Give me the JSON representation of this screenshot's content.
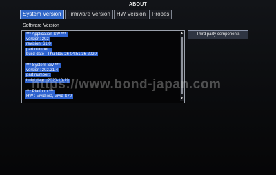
{
  "window": {
    "title": "ABOUT"
  },
  "tabs": [
    {
      "label": "System Version",
      "active": true
    },
    {
      "label": "Firmware Version",
      "active": false
    },
    {
      "label": "HW Version",
      "active": false
    },
    {
      "label": "Probes",
      "active": false
    }
  ],
  "software_version": {
    "label": "Software Version",
    "lines": [
      "*** Application SW ***",
      "version: 202",
      "revision: 61.0",
      "part number :",
      "build date : Thu Nov 26 04:51:36 2020",
      "",
      "*** System SW ***",
      "version: 202.21.4",
      "part number:",
      "build date : 2020-10-19",
      "",
      "*** Platform ***",
      "HW : Vivid i60, Vivid S70"
    ]
  },
  "buttons": {
    "third_party": "Third party components"
  },
  "watermark": "https://www.bond-japan.com",
  "colors": {
    "tab_active": "#2f66c8",
    "highlight": "#2e63d0",
    "background": "#0c0d10"
  }
}
